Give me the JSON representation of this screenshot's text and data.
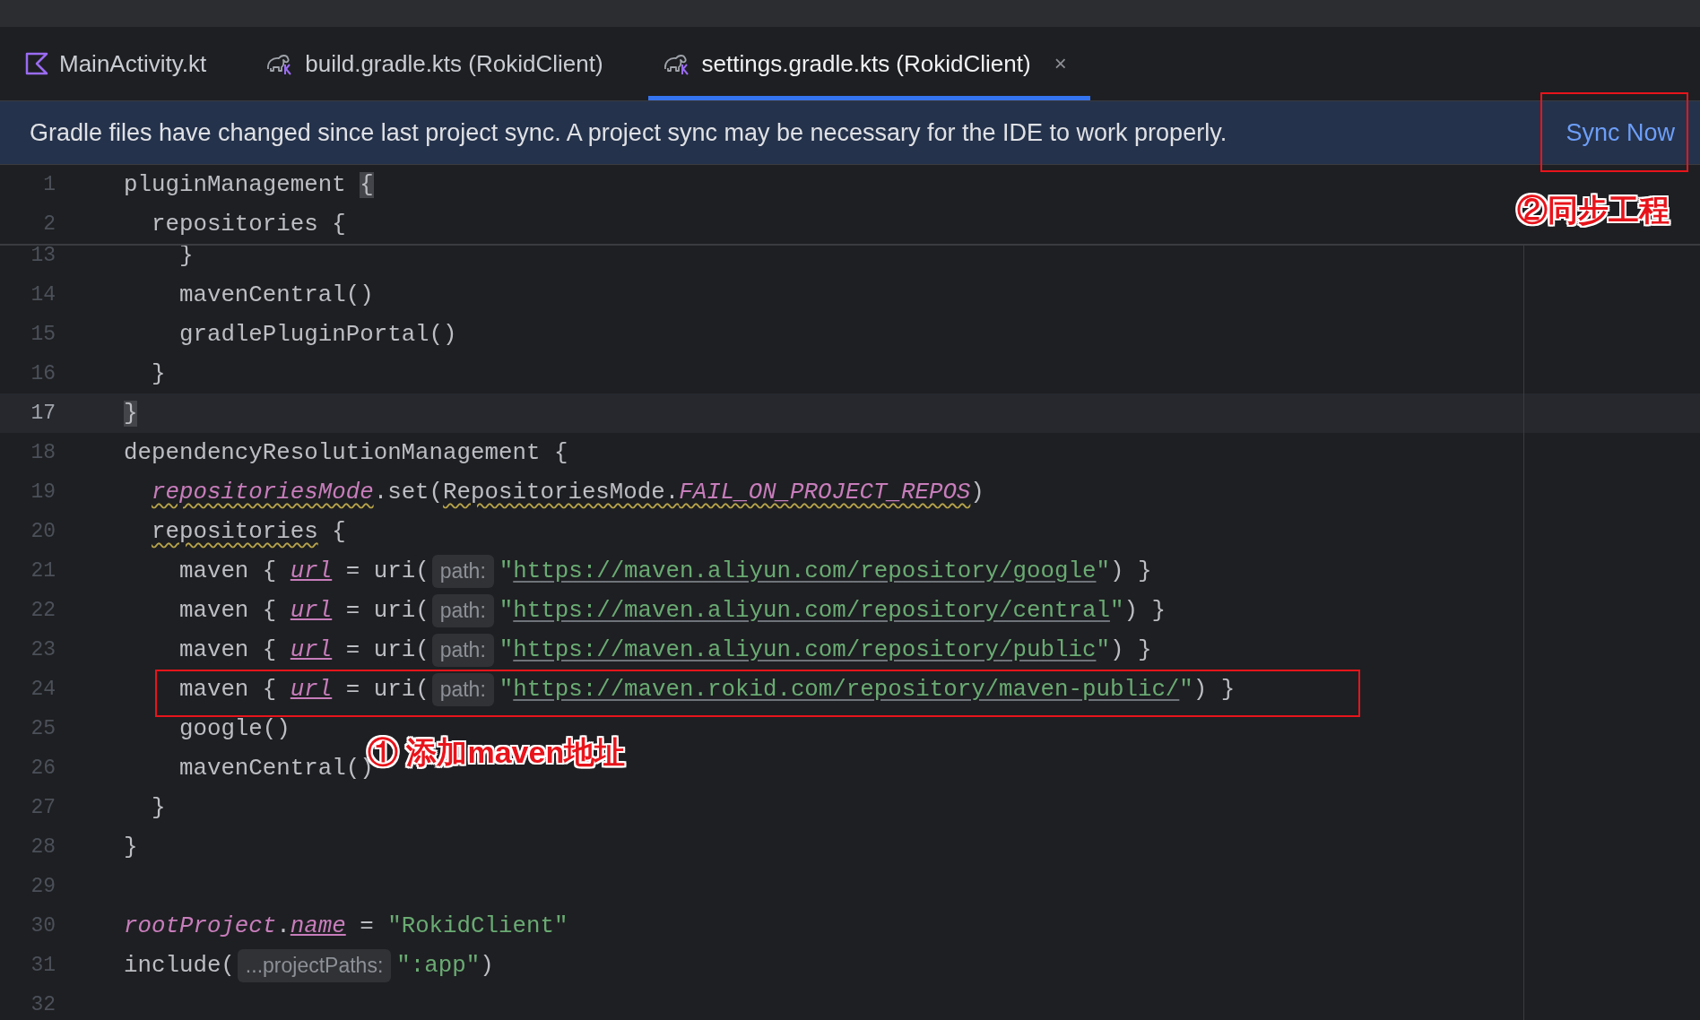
{
  "tabs": [
    {
      "label": "MainActivity.kt",
      "kind": "kotlin",
      "selected": false
    },
    {
      "label": "build.gradle.kts (RokidClient)",
      "kind": "gradle",
      "selected": false
    },
    {
      "label": "settings.gradle.kts (RokidClient)",
      "kind": "gradle",
      "selected": true,
      "close": "×"
    }
  ],
  "banner": {
    "message": "Gradle files have changed since last project sync. A project sync may be necessary for the IDE to work properly.",
    "action": "Sync Now"
  },
  "sticky_lines": [
    {
      "number": "1",
      "tokens": [
        {
          "text": "pluginManagement ",
          "kind": "plain"
        },
        {
          "text": "{",
          "kind": "brace-match"
        }
      ]
    },
    {
      "number": "2",
      "tokens": [
        {
          "text": "  repositories {",
          "kind": "plain"
        }
      ]
    }
  ],
  "lines": [
    {
      "number": "13",
      "current": false,
      "tokens": [
        {
          "text": "    }",
          "kind": "plain"
        }
      ]
    },
    {
      "number": "14",
      "current": false,
      "tokens": [
        {
          "text": "    mavenCentral()",
          "kind": "plain"
        }
      ]
    },
    {
      "number": "15",
      "current": false,
      "tokens": [
        {
          "text": "    gradlePluginPortal()",
          "kind": "plain"
        }
      ]
    },
    {
      "number": "16",
      "current": false,
      "tokens": [
        {
          "text": "  }",
          "kind": "plain"
        }
      ]
    },
    {
      "number": "17",
      "current": true,
      "tokens": [
        {
          "text": "}",
          "kind": "brace-match"
        }
      ]
    },
    {
      "number": "18",
      "current": false,
      "tokens": [
        {
          "text": "dependencyResolutionManagement {",
          "kind": "plain"
        }
      ]
    },
    {
      "number": "19",
      "current": false,
      "tokens": [
        {
          "text": "  repositoriesMode",
          "kind": "field-warn"
        },
        {
          "text": ".set(",
          "kind": "plain"
        },
        {
          "text": "RepositoriesMode.",
          "kind": "plain-warn"
        },
        {
          "text": "FAIL_ON_PROJECT_REPOS",
          "kind": "field-warn"
        },
        {
          "text": ")",
          "kind": "plain"
        }
      ]
    },
    {
      "number": "20",
      "current": false,
      "tokens": [
        {
          "text": "  repositories",
          "kind": "plain-warn"
        },
        {
          "text": " {",
          "kind": "plain"
        }
      ]
    },
    {
      "number": "21",
      "current": false,
      "tokens": [
        {
          "text": "    maven { ",
          "kind": "plain"
        },
        {
          "text": "url",
          "kind": "field-ref"
        },
        {
          "text": " = uri(",
          "kind": "plain"
        },
        {
          "text": "path:",
          "kind": "hint"
        },
        {
          "text": "\"",
          "kind": "string"
        },
        {
          "text": "https://maven.aliyun.com/repository/google",
          "kind": "url"
        },
        {
          "text": "\"",
          "kind": "string"
        },
        {
          "text": ") }",
          "kind": "plain"
        }
      ]
    },
    {
      "number": "22",
      "current": false,
      "tokens": [
        {
          "text": "    maven { ",
          "kind": "plain"
        },
        {
          "text": "url",
          "kind": "field-ref"
        },
        {
          "text": " = uri(",
          "kind": "plain"
        },
        {
          "text": "path:",
          "kind": "hint"
        },
        {
          "text": "\"",
          "kind": "string"
        },
        {
          "text": "https://maven.aliyun.com/repository/central",
          "kind": "url"
        },
        {
          "text": "\"",
          "kind": "string"
        },
        {
          "text": ") }",
          "kind": "plain"
        }
      ]
    },
    {
      "number": "23",
      "current": false,
      "tokens": [
        {
          "text": "    maven { ",
          "kind": "plain"
        },
        {
          "text": "url",
          "kind": "field-ref"
        },
        {
          "text": " = uri(",
          "kind": "plain"
        },
        {
          "text": "path:",
          "kind": "hint"
        },
        {
          "text": "\"",
          "kind": "string"
        },
        {
          "text": "https://maven.aliyun.com/repository/public",
          "kind": "url"
        },
        {
          "text": "\"",
          "kind": "string"
        },
        {
          "text": ") }",
          "kind": "plain"
        }
      ]
    },
    {
      "number": "24",
      "current": false,
      "tokens": [
        {
          "text": "    maven { ",
          "kind": "plain"
        },
        {
          "text": "url",
          "kind": "field-ref"
        },
        {
          "text": " = uri(",
          "kind": "plain"
        },
        {
          "text": "path:",
          "kind": "hint"
        },
        {
          "text": "\"",
          "kind": "string"
        },
        {
          "text": "https://maven.rokid.com/repository/maven-public/",
          "kind": "url"
        },
        {
          "text": "\"",
          "kind": "string"
        },
        {
          "text": ") }",
          "kind": "plain"
        }
      ]
    },
    {
      "number": "25",
      "current": false,
      "tokens": [
        {
          "text": "    google()",
          "kind": "plain"
        }
      ]
    },
    {
      "number": "26",
      "current": false,
      "tokens": [
        {
          "text": "    mavenCentral()",
          "kind": "plain"
        }
      ]
    },
    {
      "number": "27",
      "current": false,
      "tokens": [
        {
          "text": "  }",
          "kind": "plain"
        }
      ]
    },
    {
      "number": "28",
      "current": false,
      "tokens": [
        {
          "text": "}",
          "kind": "plain"
        }
      ]
    },
    {
      "number": "29",
      "current": false
    },
    {
      "number": "30",
      "current": false,
      "tokens": [
        {
          "text": "rootProject",
          "kind": "field"
        },
        {
          "text": ".",
          "kind": "plain"
        },
        {
          "text": "name",
          "kind": "field-ref"
        },
        {
          "text": " = ",
          "kind": "plain"
        },
        {
          "text": "\"RokidClient\"",
          "kind": "string"
        }
      ]
    },
    {
      "number": "31",
      "current": false,
      "tokens": [
        {
          "text": "include(",
          "kind": "plain"
        },
        {
          "text": "...projectPaths:",
          "kind": "hint"
        },
        {
          "text": "\":app\"",
          "kind": "string"
        },
        {
          "text": ")",
          "kind": "plain"
        }
      ]
    },
    {
      "number": "32",
      "current": false
    }
  ],
  "annotations": [
    {
      "text": "②同步工程",
      "kind": "sync"
    },
    {
      "text": "① 添加maven地址",
      "kind": "maven"
    }
  ]
}
